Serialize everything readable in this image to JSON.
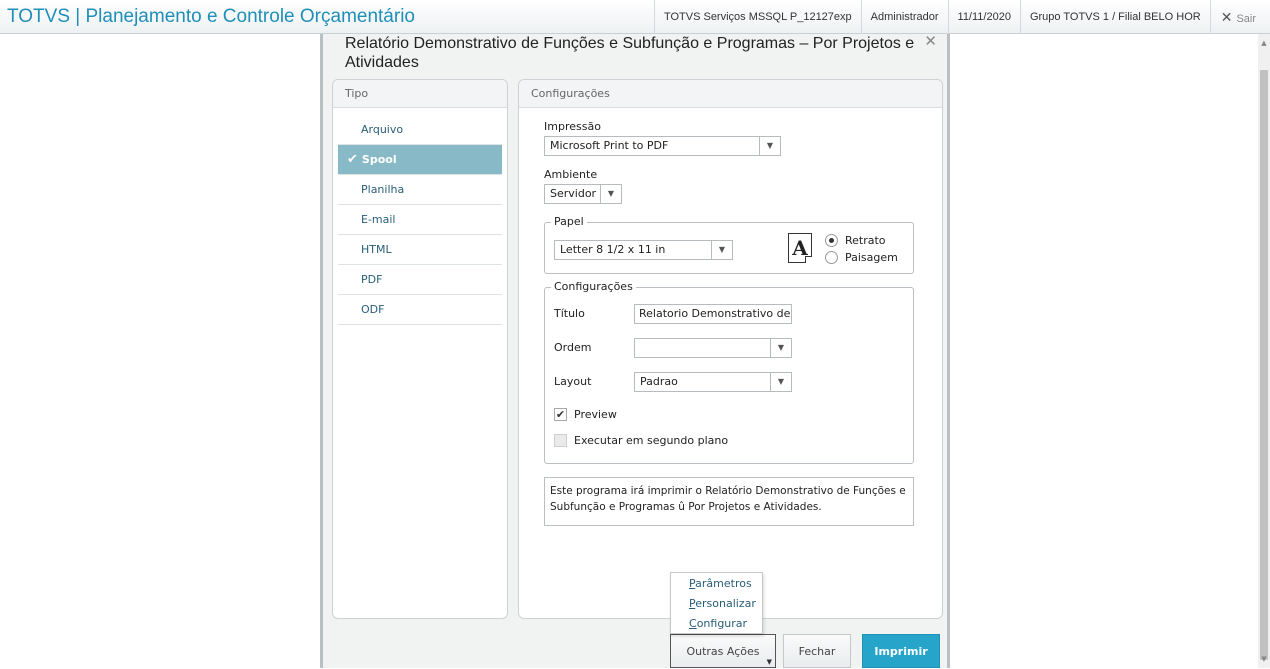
{
  "header": {
    "app_title": "TOTVS | Planejamento e Controle Orçamentário",
    "environment": "TOTVS Serviços MSSQL P_12127exp",
    "user": "Administrador",
    "date": "11/11/2020",
    "branch": "Grupo TOTVS 1 / Filial BELO HOR",
    "exit_label": "Sair"
  },
  "dialog": {
    "title": "Relatório Demonstrativo de Funções e Subfunção e Programas – Por Projetos e Atividades",
    "tipo": {
      "header": "Tipo",
      "items": [
        {
          "label": "Arquivo",
          "selected": false
        },
        {
          "label": "Spool",
          "selected": true
        },
        {
          "label": "Planilha",
          "selected": false
        },
        {
          "label": "E-mail",
          "selected": false
        },
        {
          "label": "HTML",
          "selected": false
        },
        {
          "label": "PDF",
          "selected": false
        },
        {
          "label": "ODF",
          "selected": false
        }
      ]
    },
    "configuracoes": {
      "header": "Configurações",
      "impressao": {
        "label": "Impressão",
        "value": "Microsoft Print to PDF"
      },
      "ambiente": {
        "label": "Ambiente",
        "value": "Servidor"
      },
      "papel": {
        "legend": "Papel",
        "size": "Letter 8 1/2 x 11 in",
        "orientation_icon_letter": "A",
        "retrato": {
          "label": "Retrato",
          "selected": true
        },
        "paisagem": {
          "label": "Paisagem",
          "selected": false
        }
      },
      "config_group": {
        "legend": "Configurações",
        "titulo": {
          "label": "Título",
          "value": "Relatorio Demonstrativo de Fun"
        },
        "ordem": {
          "label": "Ordem",
          "value": ""
        },
        "layout": {
          "label": "Layout",
          "value": "Padrao"
        },
        "preview": {
          "label": "Preview",
          "checked": true
        },
        "segundo_plano": {
          "label": "Executar em segundo plano",
          "checked": false
        }
      },
      "description": "Este programa irá imprimir o Relatório Demonstrativo de Funções e Subfunção e Programas û Por Projetos e Atividades."
    },
    "buttons": {
      "outras_acoes": "Outras Ações",
      "fechar": "Fechar",
      "imprimir": "Imprimir"
    },
    "outras_menu": {
      "parametros": {
        "first": "P",
        "rest": "arâmetros"
      },
      "personalizar": {
        "first": "P",
        "rest": "ersonalizar"
      },
      "configurar": {
        "first": "C",
        "rest": "onfigurar"
      }
    }
  },
  "colors": {
    "brand": "#1f8fb8",
    "selected_item_bg": "#88b9c6",
    "primary_button": "#26a4c9"
  }
}
